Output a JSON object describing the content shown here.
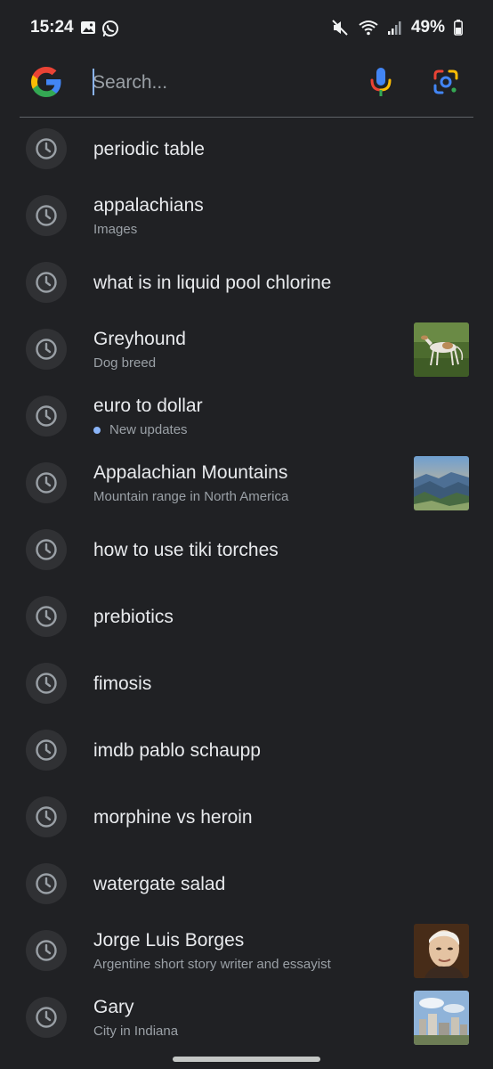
{
  "status_bar": {
    "time": "15:24",
    "battery": "49%"
  },
  "search": {
    "placeholder": "Search..."
  },
  "history": [
    {
      "title": "periodic table",
      "subtitle": "",
      "thumbnail": ""
    },
    {
      "title": "appalachians",
      "subtitle": "Images",
      "thumbnail": ""
    },
    {
      "title": "what is in liquid pool chlorine",
      "subtitle": "",
      "thumbnail": ""
    },
    {
      "title": "Greyhound",
      "subtitle": "Dog breed",
      "thumbnail": "greyhound-photo"
    },
    {
      "title": "euro to dollar",
      "subtitle": "New updates",
      "thumbnail": "",
      "update_dot": true
    },
    {
      "title": "Appalachian Mountains",
      "subtitle": "Mountain range in North America",
      "thumbnail": "mountain-photo"
    },
    {
      "title": "how to use tiki torches",
      "subtitle": "",
      "thumbnail": ""
    },
    {
      "title": "prebiotics",
      "subtitle": "",
      "thumbnail": ""
    },
    {
      "title": "fimosis",
      "subtitle": "",
      "thumbnail": ""
    },
    {
      "title": "imdb pablo schaupp",
      "subtitle": "",
      "thumbnail": ""
    },
    {
      "title": "morphine vs heroin",
      "subtitle": "",
      "thumbnail": ""
    },
    {
      "title": "watergate salad",
      "subtitle": "",
      "thumbnail": ""
    },
    {
      "title": "Jorge Luis Borges",
      "subtitle": "Argentine short story writer and essayist",
      "thumbnail": "portrait-photo"
    },
    {
      "title": "Gary",
      "subtitle": "City in Indiana",
      "thumbnail": "city-photo"
    }
  ],
  "colors": {
    "background": "#202124",
    "primary_text": "#e8eaed",
    "secondary_text": "#9aa0a6",
    "accent": "#8ab4f8"
  },
  "icons": {
    "history": "clock-icon",
    "voice": "mic-icon",
    "lens": "lens-icon"
  }
}
